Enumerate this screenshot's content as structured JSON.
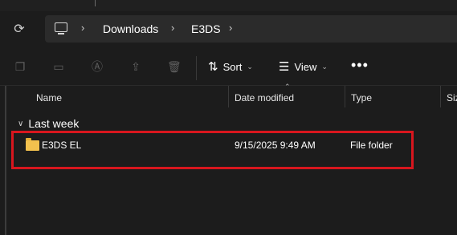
{
  "address_bar": {
    "refresh_icon": "refresh-icon",
    "location_icon": "computer-icon",
    "breadcrumbs": [
      "Downloads",
      "E3DS"
    ]
  },
  "toolbar": {
    "actions": [
      "copy-icon",
      "paste-icon",
      "rename-icon",
      "share-icon",
      "delete-icon"
    ],
    "sort_label": "Sort",
    "view_label": "View",
    "more_label": "•••"
  },
  "file_list": {
    "columns": [
      "Name",
      "Date modified",
      "Type",
      "Size"
    ],
    "groups": [
      {
        "label": "Last week",
        "items": [
          {
            "name": "E3DS EL",
            "date_modified": "9/15/2025 9:49 AM",
            "type": "File folder",
            "icon": "folder-icon"
          }
        ]
      }
    ]
  },
  "colors": {
    "background": "#1c1c1c",
    "highlight": "#d8161e",
    "folder": "#f2c14e"
  }
}
